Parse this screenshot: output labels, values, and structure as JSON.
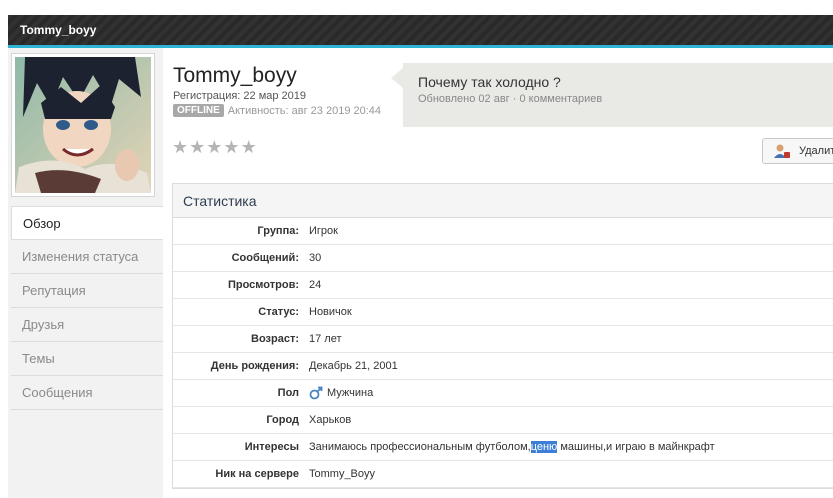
{
  "topbar": {
    "title": "Tommy_boyy"
  },
  "profile": {
    "name": "Tommy_boyy",
    "registration": "Регистрация: 22 мар 2019",
    "offline_badge": "OFFLINE",
    "activity": "Активность: авг 23 2019 20:44",
    "rating": {
      "filled": 0,
      "total": 5
    }
  },
  "status": {
    "text": "Почему так холодно ?",
    "meta": "Обновлено 02 авг · 0 комментариев"
  },
  "actions": {
    "delete_label": "Удалит"
  },
  "sidebar": {
    "tabs": [
      {
        "label": "Обзор",
        "active": true
      },
      {
        "label": "Изменения статуса"
      },
      {
        "label": "Репутация"
      },
      {
        "label": "Друзья"
      },
      {
        "label": "Темы"
      },
      {
        "label": "Сообщения"
      }
    ]
  },
  "stats": {
    "header": "Статистика",
    "rows": [
      {
        "label": "Группа:",
        "value": "Игрок"
      },
      {
        "label": "Сообщений:",
        "value": "30"
      },
      {
        "label": "Просмотров:",
        "value": "24"
      },
      {
        "label": "Статус:",
        "value": "Новичок"
      },
      {
        "label": "Возраст:",
        "value": "17 лет"
      },
      {
        "label": "День рождения:",
        "value": "Декабрь 21, 2001"
      },
      {
        "label": "Пол",
        "value": "Мужчина",
        "icon": "male-icon"
      },
      {
        "label": "Город",
        "value": "Харьков"
      },
      {
        "label": "Интересы",
        "value_before": "Занимаюсь профессиональным футболом,",
        "value_highlight": "ценю",
        "value_after": " машины,и играю в майнкрафт"
      },
      {
        "label": "Ник на сервере",
        "value": "Tommy_Boyy"
      }
    ]
  },
  "colors": {
    "accent": "#2fb3d4",
    "topbar": "#2b2b2b",
    "highlight": "#3d7fd6"
  }
}
